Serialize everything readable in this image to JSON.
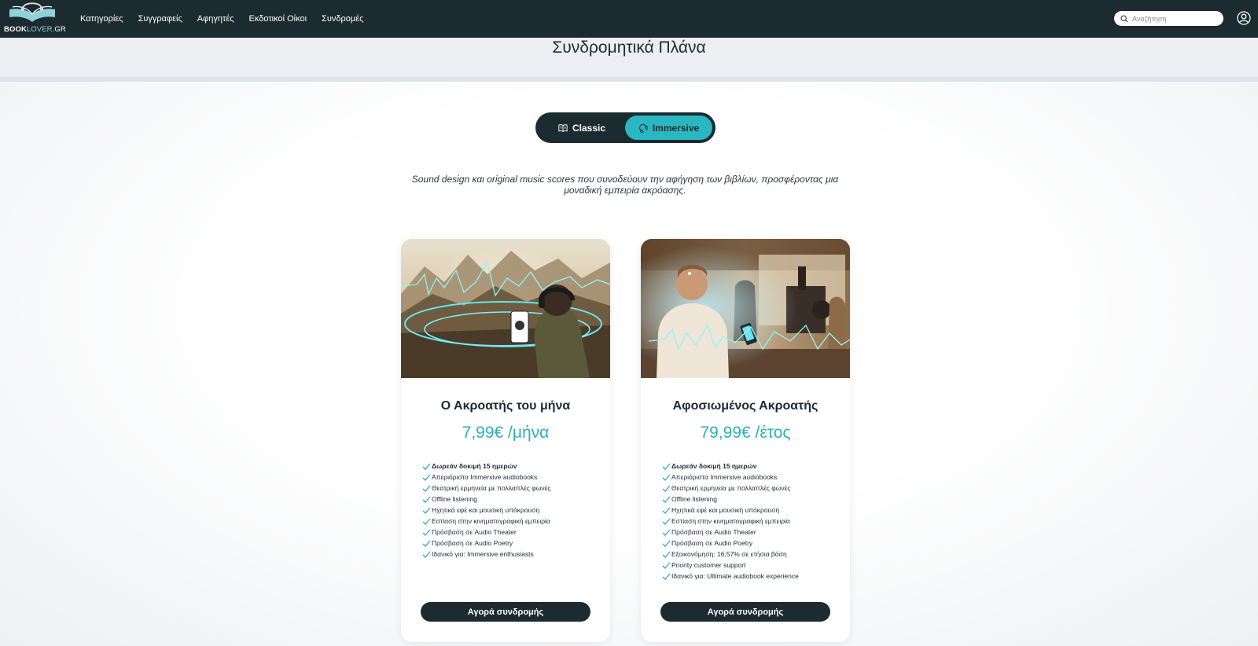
{
  "brand": {
    "name_bold": "BOOK",
    "name_accent": "LOVER",
    "name_domain": ".GR"
  },
  "nav": {
    "links": [
      "Κατηγορίες",
      "Συγγραφείς",
      "Αφηγητές",
      "Εκδοτικοί Οίκοι",
      "Συνδρομές"
    ]
  },
  "search": {
    "placeholder": "Αναζήτηση",
    "icon": "search-icon"
  },
  "header": {
    "title": "Συνδρομητικά Πλάνα"
  },
  "toggle": {
    "options": [
      {
        "label": "Classic",
        "icon": "book-open-icon",
        "active": false
      },
      {
        "label": "Immersive",
        "icon": "headphones-icon",
        "active": true
      }
    ]
  },
  "subtitle": "Sound design και original music scores που συνοδεύουν την αφήγηση των βιβλίων, προσφέροντας μια μοναδική εμπειρία ακρόασης.",
  "plans": [
    {
      "title": "Ο Ακροατής του μήνα",
      "price": "7,99€ /μήνα",
      "features": [
        "Δωρεάν δοκιμή 15 ημερών",
        "Απεριόριστα Immersive audiobooks",
        "Θεατρική ερμηνεία με πολλαπλές φωνές",
        "Offline listening",
        "Ηχητικά εφέ και μουσική υπόκρουση",
        "Εστίαση στην κινηματογραφική εμπειρία",
        "Πρόσβαση σε Audio Theater",
        "Πρόσβαση σε Audio Poetry",
        "Ιδανικό για: Immersive enthusiasts"
      ],
      "button": "Αγορά συνδρομής"
    },
    {
      "title": "Αφοσιωμένος Ακροατής",
      "price": "79,99€ /έτος",
      "features": [
        "Δωρεάν δοκιμή 15 ημερών",
        "Απεριόριστα Immersive audiobooks",
        "Θεατρική ερμηνεία με πολλαπλές φωνές",
        "Offline listening",
        "Ηχητικά εφέ και μουσική υπόκρουση",
        "Εστίαση στην κινηματογραφική εμπειρία",
        "Πρόσβαση σε Audio Theater",
        "Πρόσβαση σε Audio Poetry",
        "Εξοικονόμηση: 16,57% σε ετήσια βάση",
        "Priority customer support",
        "Ιδανικό για: Ultimate audiobook experience"
      ],
      "button": "Αγορά συνδρομής"
    }
  ],
  "colors": {
    "navbar": "#1b2b30",
    "accent": "#2bb7c2",
    "price": "#2bb0ba"
  }
}
